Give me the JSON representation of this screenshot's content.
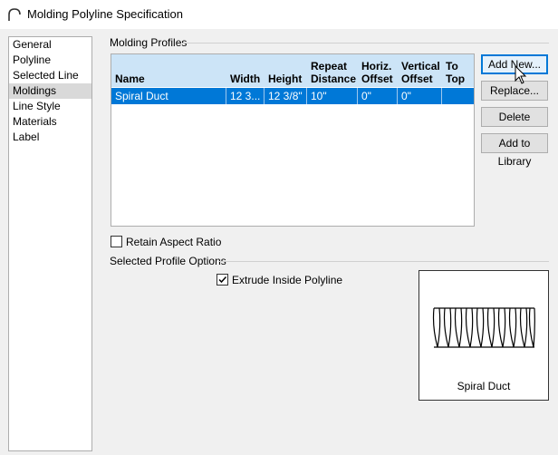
{
  "window": {
    "title": "Molding Polyline Specification"
  },
  "sidebar": {
    "items": [
      {
        "label": "General"
      },
      {
        "label": "Polyline"
      },
      {
        "label": "Selected Line"
      },
      {
        "label": "Moldings",
        "selected": true
      },
      {
        "label": "Line Style"
      },
      {
        "label": "Materials"
      },
      {
        "label": "Label"
      }
    ]
  },
  "profiles": {
    "group_label": "Molding Profiles",
    "columns": [
      {
        "line1": "",
        "line2": "Name"
      },
      {
        "line1": "",
        "line2": "Width"
      },
      {
        "line1": "",
        "line2": "Height"
      },
      {
        "line1": "Repeat",
        "line2": "Distance"
      },
      {
        "line1": "Horiz.",
        "line2": "Offset"
      },
      {
        "line1": "Vertical",
        "line2": "Offset"
      },
      {
        "line1": "To",
        "line2": "Top"
      }
    ],
    "rows": [
      [
        "Spiral Duct",
        "12 3...",
        "12 3/8\"",
        "10\"",
        "0\"",
        "0\"",
        ""
      ]
    ]
  },
  "buttons": {
    "add_new": "Add New...",
    "replace": "Replace...",
    "delete": "Delete",
    "add_to_library": "Add to Library"
  },
  "retain_aspect": {
    "label": "Retain Aspect Ratio",
    "checked": false
  },
  "options": {
    "group_label": "Selected Profile Options",
    "extrude_label": "Extrude Inside Polyline",
    "extrude_checked": true
  },
  "preview": {
    "label": "Spiral Duct"
  },
  "colors": {
    "selection": "#0078d7",
    "header": "#cce4f7"
  }
}
